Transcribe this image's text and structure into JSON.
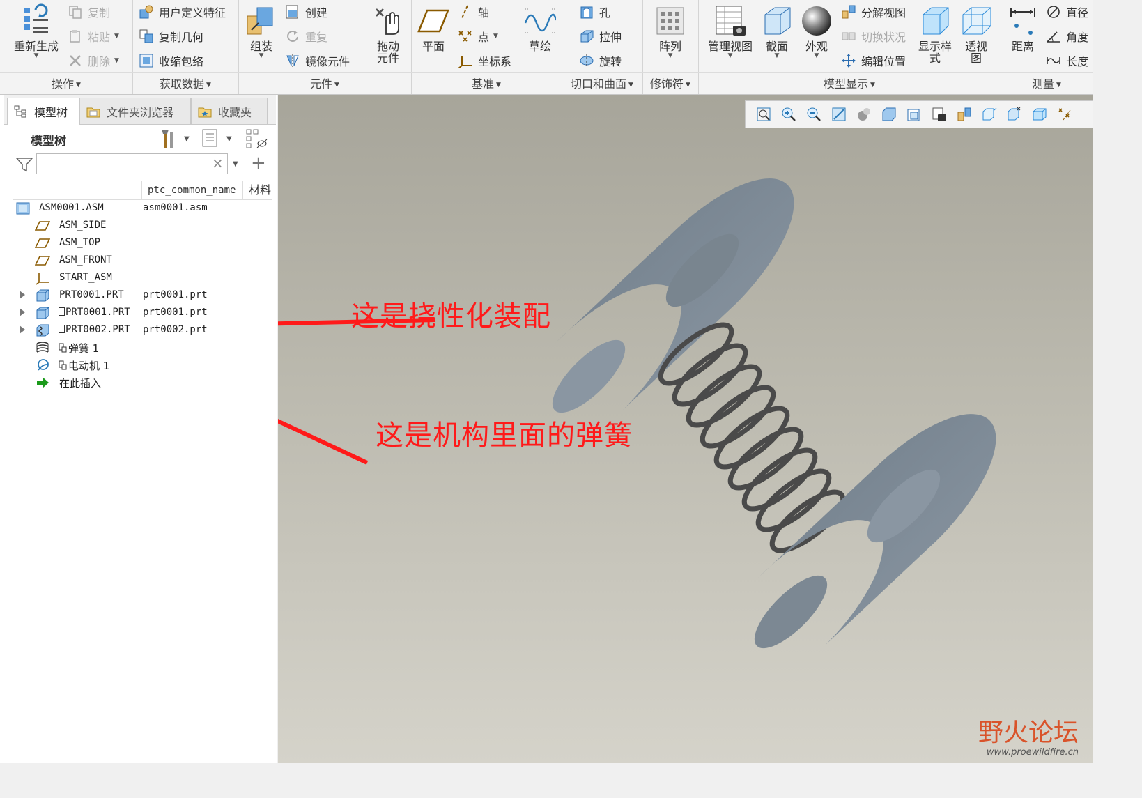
{
  "ribbon": {
    "operations": {
      "regenerate": "重新生成",
      "copy": "复制",
      "paste": "粘贴",
      "delete": "删除",
      "group_label": "操作"
    },
    "get_data": {
      "udf": "用户定义特征",
      "copy_geom": "复制几何",
      "shrinkwrap": "收缩包络",
      "group_label": "获取数据"
    },
    "component": {
      "assemble": "组装",
      "create": "创建",
      "repeat": "重复",
      "mirror": "镜像元件",
      "drag": "拖动\n元件",
      "group_label": "元件"
    },
    "datum": {
      "plane": "平面",
      "axis": "轴",
      "point": "点",
      "csys": "坐标系",
      "sketch": "草绘",
      "group_label": "基准"
    },
    "cut_surface": {
      "hole": "孔",
      "extrude": "拉伸",
      "revolve": "旋转",
      "group_label": "切口和曲面"
    },
    "modifiers": {
      "pattern": "阵列",
      "group_label": "修饰符"
    },
    "model_display": {
      "manage_views": "管理视图",
      "section": "截面",
      "appearance": "外观",
      "explode_view": "分解视图",
      "toggle_status": "切换状况",
      "edit_position": "编辑位置",
      "display_style": "显示样\n式",
      "perspective": "透视\n图",
      "group_label": "模型显示"
    },
    "measure": {
      "distance": "距离",
      "diameter": "直径",
      "angle": "角度",
      "length": "长度",
      "group_label": "测量"
    }
  },
  "nav_tabs": [
    "模型树",
    "文件夹浏览器",
    "收藏夹"
  ],
  "model_tree": {
    "title": "模型树",
    "search_value": "",
    "columns": [
      "ptc_common_name",
      "材料"
    ],
    "rows": [
      {
        "name": "ASM0001.ASM",
        "common": "asm0001.asm"
      },
      {
        "name": "ASM_SIDE",
        "common": ""
      },
      {
        "name": "ASM_TOP",
        "common": ""
      },
      {
        "name": "ASM_FRONT",
        "common": ""
      },
      {
        "name": "START_ASM",
        "common": ""
      },
      {
        "name": "PRT0001.PRT",
        "common": "prt0001.prt"
      },
      {
        "name": "PRT0001.PRT",
        "common": "prt0001.prt"
      },
      {
        "name": "PRT0002.PRT",
        "common": "prt0002.prt"
      },
      {
        "name": "弹簧 1",
        "common": ""
      },
      {
        "name": "电动机 1",
        "common": ""
      },
      {
        "name": "在此插入",
        "common": ""
      }
    ]
  },
  "annotations": {
    "flexible": "这是挠性化装配",
    "spring": "这是机构里面的弹簧"
  },
  "watermark": {
    "brand": "野火论坛",
    "url": "www.proewildfire.cn"
  },
  "colors": {
    "annotation": "#ff1a1a",
    "accent": "#2a7ab8"
  }
}
